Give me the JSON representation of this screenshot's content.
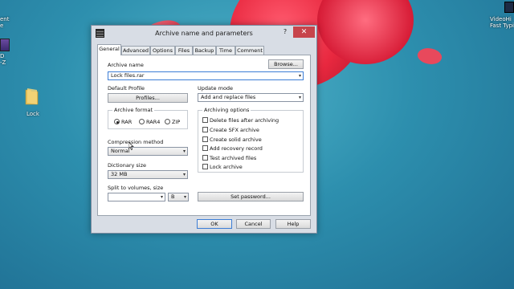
{
  "desktop": {
    "top_left_label_1": "ent",
    "top_left_label_2": "e",
    "left_label_1": "D",
    "left_label_2": "-Z",
    "folder_label": "Lock",
    "top_right_label_1": "VideoHi",
    "top_right_label_2": "Fast Typi"
  },
  "dialog": {
    "title": "Archive name and parameters",
    "help_glyph": "?",
    "close_glyph": "✕",
    "tabs": [
      "General",
      "Advanced",
      "Options",
      "Files",
      "Backup",
      "Time",
      "Comment"
    ],
    "archive_name_label": "Archive name",
    "browse_label": "Browse...",
    "archive_name_value": "Lock files.rar",
    "default_profile_label": "Default Profile",
    "profiles_label": "Profiles...",
    "update_mode_label": "Update mode",
    "update_mode_value": "Add and replace files",
    "archive_format_label": "Archive format",
    "formats": [
      "RAR",
      "RAR4",
      "ZIP"
    ],
    "selected_format": "RAR",
    "archiving_options_label": "Archiving options",
    "options": [
      "Delete files after archiving",
      "Create SFX archive",
      "Create solid archive",
      "Add recovery record",
      "Test archived files",
      "Lock archive"
    ],
    "compression_method_label": "Compression method",
    "compression_method_value": "Normal",
    "dictionary_size_label": "Dictionary size",
    "dictionary_size_value": "32 MB",
    "split_label": "Split to volumes, size",
    "split_value": "",
    "split_unit": "B",
    "set_password_label": "Set password...",
    "ok_label": "OK",
    "cancel_label": "Cancel",
    "help_label": "Help"
  }
}
